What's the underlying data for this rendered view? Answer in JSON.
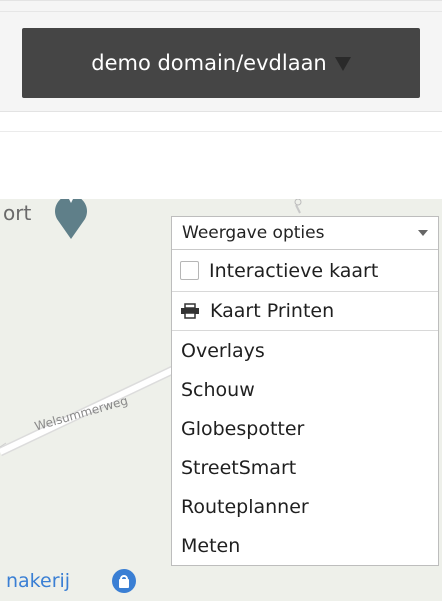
{
  "header": {
    "domain_label": "demo domain/evdlaan"
  },
  "map": {
    "place_label": "ort",
    "street_label": "Welsummerweg",
    "bottom_label": "nakerij"
  },
  "panel": {
    "title": "Weergave opties",
    "checkbox_label": "Interactieve kaart",
    "print_label": "Kaart Printen",
    "items": [
      "Overlays",
      "Schouw",
      "Globespotter",
      "StreetSmart",
      "Routeplanner",
      "Meten"
    ]
  },
  "colors": {
    "header_button_bg": "#454545",
    "map_bg": "#eef0ea",
    "pin": "#5f7f89",
    "accent_blue": "#3a7fd4"
  },
  "icons": {
    "domain_dropdown": "caret-down-icon",
    "map_pin": "map-pin-icon",
    "print": "printer-icon",
    "bottom_poi": "bag-poi-icon"
  }
}
